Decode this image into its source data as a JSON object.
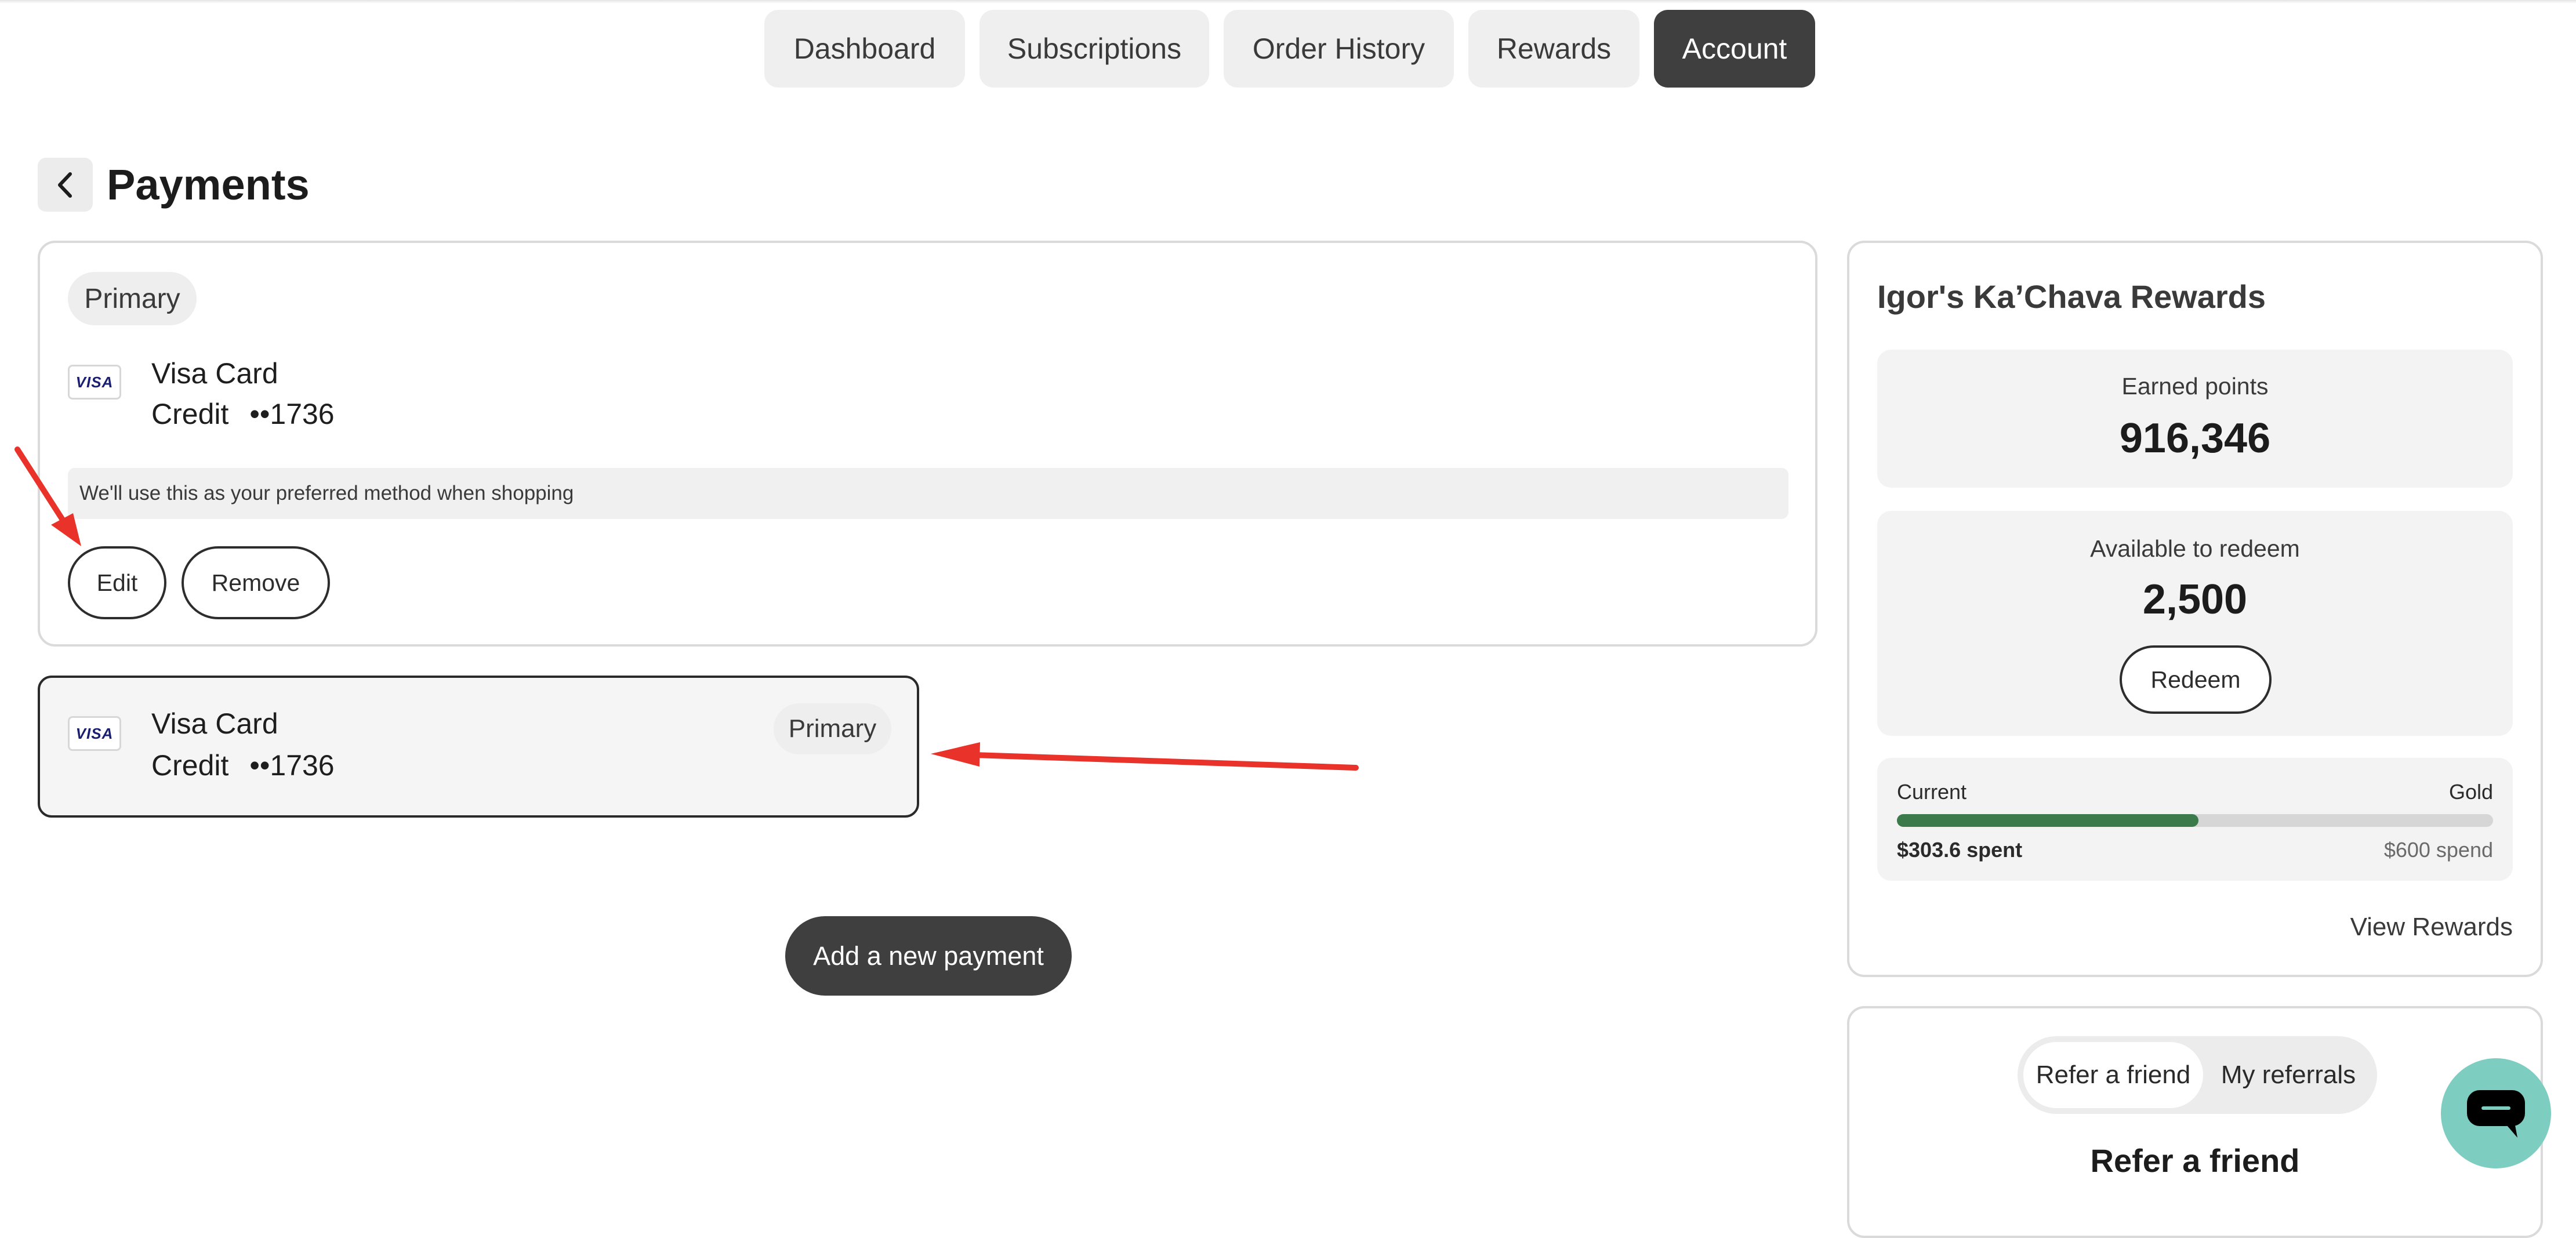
{
  "nav": {
    "tabs": [
      {
        "label": "Dashboard"
      },
      {
        "label": "Subscriptions"
      },
      {
        "label": "Order History"
      },
      {
        "label": "Rewards"
      },
      {
        "label": "Account",
        "active": true
      }
    ]
  },
  "page": {
    "title": "Payments"
  },
  "payments": {
    "primary_card": {
      "badge": "Primary",
      "brand": "VISA",
      "name": "Visa Card",
      "type": "Credit",
      "number_masked": "••1736",
      "note": "We'll use this as your preferred method when shopping",
      "edit_label": "Edit",
      "remove_label": "Remove"
    },
    "second_card": {
      "brand": "VISA",
      "name": "Visa Card",
      "type": "Credit",
      "number_masked": "••1736",
      "badge": "Primary"
    },
    "add_label": "Add a new payment"
  },
  "rewards": {
    "title": "Igor's Ka’Chava Rewards",
    "earned_label": "Earned points",
    "earned_value": "916,346",
    "available_label": "Available to redeem",
    "available_value": "2,500",
    "redeem_label": "Redeem",
    "tier": {
      "current_label": "Current",
      "next_label": "Gold",
      "spent": "$303.6 spent",
      "goal": "$600 spend",
      "progress": 0.506,
      "bar_color": "#3b7a4a"
    },
    "view_label": "View Rewards"
  },
  "referral": {
    "tab_refer": "Refer a friend",
    "tab_referrals": "My referrals",
    "heading": "Refer a friend"
  },
  "colors": {
    "accent_dark": "#3f3f3f",
    "annotation": "#e8322a",
    "chat": "#7ecdc1"
  },
  "icons": {
    "back": "chevron-left-icon",
    "chat": "chat-bubble-icon"
  }
}
